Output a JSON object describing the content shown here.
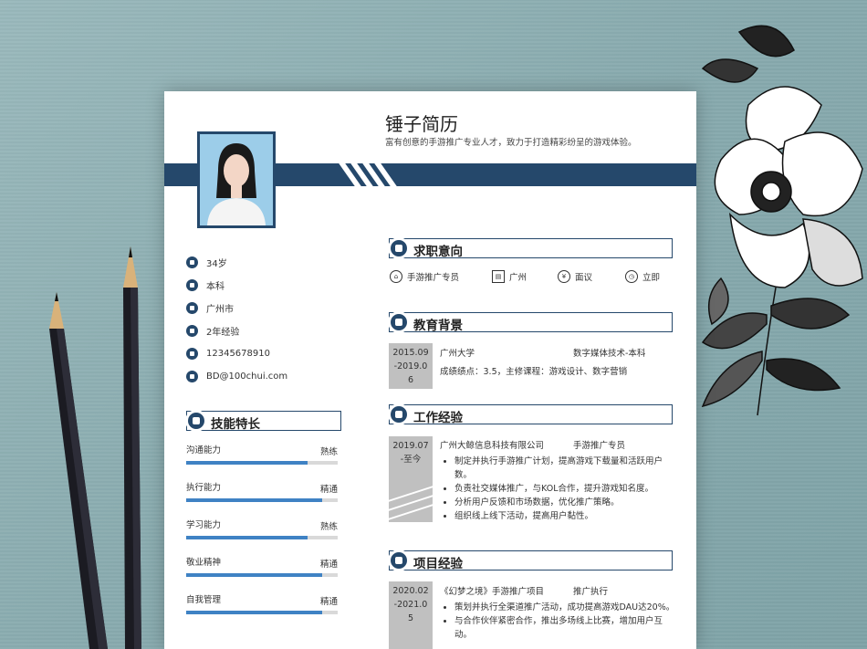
{
  "header": {
    "name": "锤子简历",
    "tagline": "富有创意的手游推广专业人才，致力于打造精彩纷呈的游戏体验。"
  },
  "info": [
    {
      "icon": "age-icon",
      "text": "34岁"
    },
    {
      "icon": "education-icon",
      "text": "本科"
    },
    {
      "icon": "location-icon",
      "text": "广州市"
    },
    {
      "icon": "experience-icon",
      "text": "2年经验"
    },
    {
      "icon": "phone-icon",
      "text": "12345678910"
    },
    {
      "icon": "email-icon",
      "text": "BD@100chui.com"
    }
  ],
  "skills_title": "技能特长",
  "skills": [
    {
      "name": "沟通能力",
      "level": "熟练",
      "percent": 80
    },
    {
      "name": "执行能力",
      "level": "精通",
      "percent": 90
    },
    {
      "name": "学习能力",
      "level": "熟练",
      "percent": 80
    },
    {
      "name": "敬业精神",
      "level": "精通",
      "percent": 90
    },
    {
      "name": "自我管理",
      "level": "精通",
      "percent": 90
    }
  ],
  "intent": {
    "title": "求职意向",
    "position": "手游推广专员",
    "city": "广州",
    "salary": "面议",
    "availability": "立即"
  },
  "education": {
    "title": "教育背景",
    "date": [
      "2015.09",
      "-2019.0",
      "6"
    ],
    "school": "广州大学",
    "major": "数字媒体技术-本科",
    "detail": "成绩绩点：3.5，主修课程：游戏设计、数字营销"
  },
  "work": {
    "title": "工作经验",
    "date": [
      "2019.07",
      "-至今"
    ],
    "company": "广州大鲸信息科技有限公司",
    "role": "手游推广专员",
    "bullets": [
      "制定并执行手游推广计划，提高游戏下载量和活跃用户数。",
      "负责社交媒体推广，与KOL合作，提升游戏知名度。",
      "分析用户反馈和市场数据，优化推广策略。",
      "组织线上线下活动，提高用户黏性。"
    ]
  },
  "project": {
    "title": "项目经验",
    "date": [
      "2020.02",
      "-2021.0",
      "5"
    ],
    "name": "《幻梦之境》手游推广项目",
    "role": "推广执行",
    "bullets": [
      "策划并执行全渠道推广活动，成功提高游戏DAU达20%。",
      "与合作伙伴紧密合作，推出多场线上比赛，增加用户互动。"
    ]
  },
  "colors": {
    "accent": "#25486b",
    "bar": "#3f82c4",
    "date_bg": "#c0c0c0"
  }
}
